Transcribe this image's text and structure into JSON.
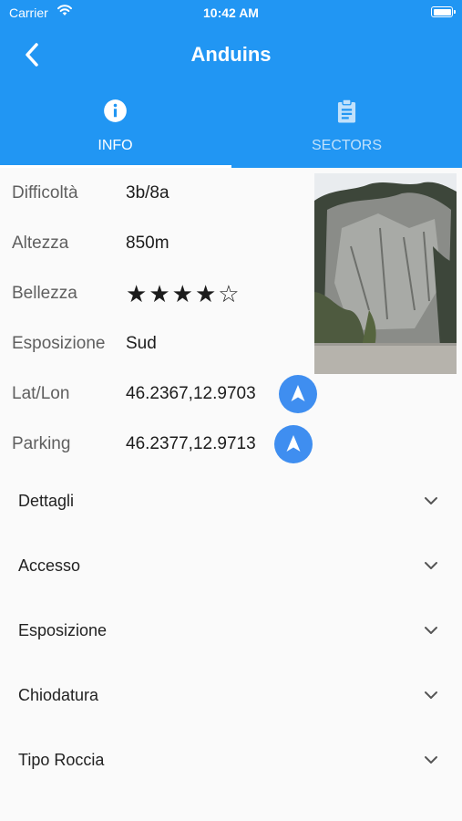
{
  "status_bar": {
    "carrier": "Carrier",
    "time": "10:42 AM"
  },
  "header": {
    "title": "Anduins"
  },
  "tabs": [
    {
      "label": "INFO",
      "icon": "info-icon",
      "selected": true
    },
    {
      "label": "SECTORS",
      "icon": "clipboard-icon",
      "selected": false
    }
  ],
  "info": {
    "difficolta": {
      "label": "Difficoltà",
      "value": "3b/8a"
    },
    "altezza": {
      "label": "Altezza",
      "value": "850m"
    },
    "bellezza": {
      "label": "Bellezza",
      "rating": 4,
      "max": 5
    },
    "esposizione": {
      "label": "Esposizione",
      "value": "Sud"
    },
    "latlon": {
      "label": "Lat/Lon",
      "value": "46.2367,12.9703"
    },
    "parking": {
      "label": "Parking",
      "value": "46.2377,12.9713"
    }
  },
  "sections": [
    {
      "label": "Dettagli"
    },
    {
      "label": "Accesso"
    },
    {
      "label": "Esposizione"
    },
    {
      "label": "Chiodatura"
    },
    {
      "label": "Tipo Roccia"
    }
  ],
  "colors": {
    "primary": "#2196f3",
    "nav_button": "#3f8ef0",
    "background": "#fafafa"
  }
}
